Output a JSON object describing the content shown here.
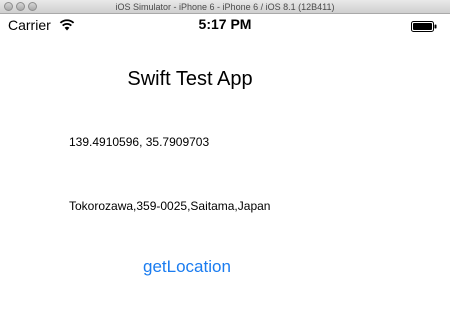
{
  "window": {
    "title": "iOS Simulator - iPhone 6 - iPhone 6 / iOS 8.1 (12B411)"
  },
  "status_bar": {
    "carrier": "Carrier",
    "time": "5:17 PM",
    "icons": [
      "wifi-icon",
      "battery-icon"
    ]
  },
  "app": {
    "title": "Swift Test App",
    "coordinates": "139.4910596, 35.7909703",
    "address": "Tokorozawa,359-0025,Saitama,Japan",
    "button_label": "getLocation"
  },
  "colors": {
    "button_text": "#1a7cf0",
    "background": "#ffffff",
    "text": "#000000"
  }
}
